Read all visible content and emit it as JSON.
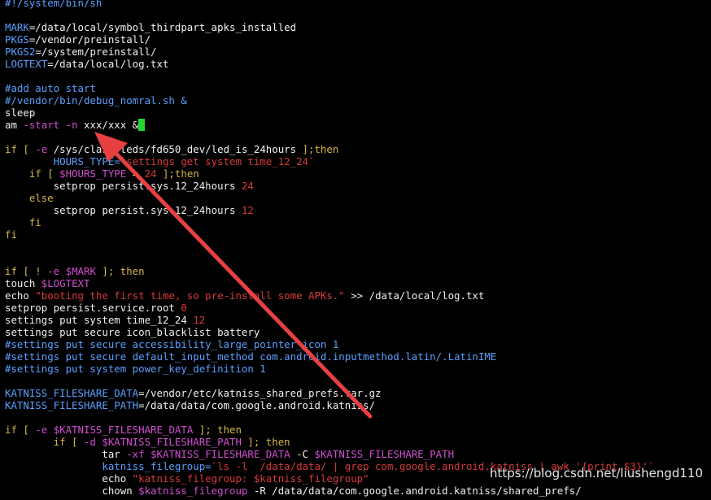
{
  "colors": {
    "comment": "#5aa0ff",
    "keyword": "#d7b84a",
    "variable": "#d24ed2",
    "string": "#d83a3a",
    "option": "#d24ed2",
    "number": "#d83a3a",
    "text": "#f0f0f0",
    "cursor": "#22d82e",
    "arrow": "#e84040"
  },
  "terminal": {
    "lines": [
      [
        {
          "t": "#!/system/bin/sh",
          "c": "comment"
        }
      ],
      [],
      [
        {
          "t": "MARK",
          "c": "comment"
        },
        {
          "t": "=/data/local/symbol_thirdpart_apks_installed",
          "c": "text"
        }
      ],
      [
        {
          "t": "PKGS",
          "c": "comment"
        },
        {
          "t": "=/vendor/preinstall/",
          "c": "text"
        }
      ],
      [
        {
          "t": "PKGS2",
          "c": "comment"
        },
        {
          "t": "=/system/preinstall/",
          "c": "text"
        }
      ],
      [
        {
          "t": "LOGTEXT",
          "c": "comment"
        },
        {
          "t": "=/data/local/log.txt",
          "c": "text"
        }
      ],
      [],
      [
        {
          "t": "#add auto start",
          "c": "comment"
        }
      ],
      [
        {
          "t": "#/vendor/bin/debug_nomral.sh &",
          "c": "comment"
        }
      ],
      [
        {
          "t": "sleep",
          "c": "text"
        }
      ],
      [
        {
          "t": "am ",
          "c": "text"
        },
        {
          "t": "-start -n",
          "c": "option"
        },
        {
          "t": " xxx/xxx &",
          "c": "text"
        },
        {
          "t": " ",
          "c": "cursor"
        }
      ],
      [],
      [
        {
          "t": "if [ ",
          "c": "keyword"
        },
        {
          "t": "-e",
          "c": "option"
        },
        {
          "t": " /sys/class/leds/fd650_dev/led_is_24hours ",
          "c": "text"
        },
        {
          "t": "];then",
          "c": "keyword"
        }
      ],
      [
        {
          "t": "        HOURS_TYPE=",
          "c": "comment"
        },
        {
          "t": "`settings get system time_12_24`",
          "c": "string"
        }
      ],
      [
        {
          "t": "    if [ ",
          "c": "keyword"
        },
        {
          "t": "$HOURS_TYPE",
          "c": "variable"
        },
        {
          "t": " = ",
          "c": "text"
        },
        {
          "t": "24",
          "c": "number"
        },
        {
          "t": " ];then",
          "c": "keyword"
        }
      ],
      [
        {
          "t": "        setprop persist.sys.12_24hours ",
          "c": "text"
        },
        {
          "t": "24",
          "c": "number"
        }
      ],
      [
        {
          "t": "    else",
          "c": "keyword"
        }
      ],
      [
        {
          "t": "        setprop persist.sys.12_24hours ",
          "c": "text"
        },
        {
          "t": "12",
          "c": "number"
        }
      ],
      [
        {
          "t": "    fi",
          "c": "keyword"
        }
      ],
      [
        {
          "t": "fi",
          "c": "keyword"
        }
      ],
      [],
      [],
      [
        {
          "t": "if [ ! ",
          "c": "keyword"
        },
        {
          "t": "-e",
          "c": "option"
        },
        {
          "t": " ",
          "c": "text"
        },
        {
          "t": "$MARK",
          "c": "variable"
        },
        {
          "t": " ]; then",
          "c": "keyword"
        }
      ],
      [
        {
          "t": "touch ",
          "c": "text"
        },
        {
          "t": "$LOGTEXT",
          "c": "variable"
        }
      ],
      [
        {
          "t": "echo ",
          "c": "text"
        },
        {
          "t": "\"booting the first time, so pre-install some APKs.\"",
          "c": "string"
        },
        {
          "t": " >> /data/local/log.txt",
          "c": "text"
        }
      ],
      [
        {
          "t": "setprop persist.service.root ",
          "c": "text"
        },
        {
          "t": "0",
          "c": "number"
        }
      ],
      [
        {
          "t": "settings put system time_12_24 ",
          "c": "text"
        },
        {
          "t": "12",
          "c": "number"
        }
      ],
      [
        {
          "t": "settings put secure icon_blacklist battery",
          "c": "text"
        }
      ],
      [
        {
          "t": "#settings put secure accessibility_large_pointer_icon 1",
          "c": "comment"
        }
      ],
      [
        {
          "t": "#settings put secure default_input_method com.android.inputmethod.latin/.LatinIME",
          "c": "comment"
        }
      ],
      [
        {
          "t": "#settings put system power_key_definition 1",
          "c": "comment"
        }
      ],
      [],
      [
        {
          "t": "KATNISS_FILESHARE_DATA",
          "c": "comment"
        },
        {
          "t": "=/vendor/etc/katniss_shared_prefs.tar.gz",
          "c": "text"
        }
      ],
      [
        {
          "t": "KATNISS_FILESHARE_PATH",
          "c": "comment"
        },
        {
          "t": "=/data/data/com.google.android.katniss/",
          "c": "text"
        }
      ],
      [],
      [
        {
          "t": "if [ ",
          "c": "keyword"
        },
        {
          "t": "-e",
          "c": "option"
        },
        {
          "t": " ",
          "c": "text"
        },
        {
          "t": "$KATNISS_FILESHARE_DATA",
          "c": "variable"
        },
        {
          "t": " ]; then",
          "c": "keyword"
        }
      ],
      [
        {
          "t": "        if [ ",
          "c": "keyword"
        },
        {
          "t": "-d",
          "c": "option"
        },
        {
          "t": " ",
          "c": "text"
        },
        {
          "t": "$KATNISS_FILESHARE_PATH",
          "c": "variable"
        },
        {
          "t": " ]; then",
          "c": "keyword"
        }
      ],
      [
        {
          "t": "                tar ",
          "c": "text"
        },
        {
          "t": "-xf",
          "c": "option"
        },
        {
          "t": " ",
          "c": "text"
        },
        {
          "t": "$KATNISS_FILESHARE_DATA",
          "c": "variable"
        },
        {
          "t": " -C ",
          "c": "text"
        },
        {
          "t": "$KATNISS_FILESHARE_PATH",
          "c": "variable"
        }
      ],
      [
        {
          "t": "                katniss_filegroup=",
          "c": "comment"
        },
        {
          "t": "`ls -l  /data/data/ | grep com.google.android.katniss | awk '{print $3}'`",
          "c": "string"
        }
      ],
      [
        {
          "t": "                echo ",
          "c": "text"
        },
        {
          "t": "\"katniss_filegroup: $katniss_filegroup\"",
          "c": "string"
        }
      ],
      [
        {
          "t": "                chown ",
          "c": "text"
        },
        {
          "t": "$katniss_filegroup",
          "c": "variable"
        },
        {
          "t": " -R /data/data/com.google.android.katniss/shared_prefs/",
          "c": "text"
        }
      ]
    ]
  },
  "watermark": {
    "text": "https://blog.csdn.net/liushengd110"
  }
}
